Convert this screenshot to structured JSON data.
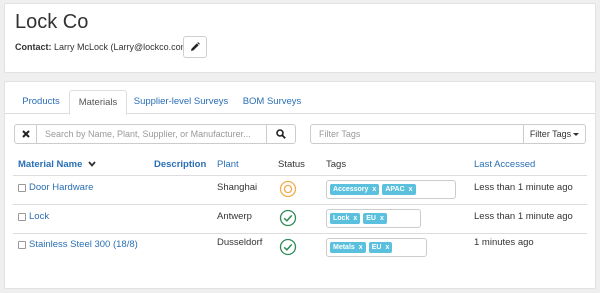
{
  "header": {
    "company_name": "Lock Co",
    "contact_label": "Contact:",
    "contact_value": "Larry McLock (Larry@lockco.com)"
  },
  "tabs": [
    {
      "label": "Products",
      "active": false
    },
    {
      "label": "Materials",
      "active": true
    },
    {
      "label": "Supplier-level Surveys",
      "active": false
    },
    {
      "label": "BOM Surveys",
      "active": false
    }
  ],
  "search": {
    "placeholder": "Search by Name, Plant, Supplier, or Manufacturer...",
    "value": ""
  },
  "filter_tags": {
    "placeholder": "Filter Tags",
    "dropdown_label": "Filter Tags"
  },
  "table": {
    "columns": {
      "material_name": "Material Name",
      "description": "Description",
      "plant": "Plant",
      "status": "Status",
      "tags": "Tags",
      "last_accessed": "Last Accessed"
    },
    "rows": [
      {
        "name": "Door Hardware",
        "description": "",
        "plant": "Shanghai",
        "status": "pending",
        "tags": [
          "Accessory",
          "APAC"
        ],
        "last_accessed": "Less than 1 minute ago"
      },
      {
        "name": "Lock",
        "description": "",
        "plant": "Antwerp",
        "status": "complete",
        "tags": [
          "Lock",
          "EU"
        ],
        "last_accessed": "Less than 1 minute ago"
      },
      {
        "name": "Stainless Steel 300 (18/8)",
        "description": "",
        "plant": "Dusseldorf",
        "status": "complete",
        "tags": [
          "Metals",
          "EU"
        ],
        "last_accessed": "1 minutes ago"
      }
    ]
  },
  "icons": {
    "edit": "pencil-icon",
    "clear": "times-icon",
    "search": "search-icon",
    "sort": "chevron-down-icon",
    "status_pending": "circle-pending-icon",
    "status_complete": "check-circle-icon",
    "tag_remove": "x"
  },
  "colors": {
    "link": "#2a6fb5",
    "tag": "#5bc0de",
    "status_pending": "#f0ad4e",
    "status_complete": "#2e8b57"
  }
}
